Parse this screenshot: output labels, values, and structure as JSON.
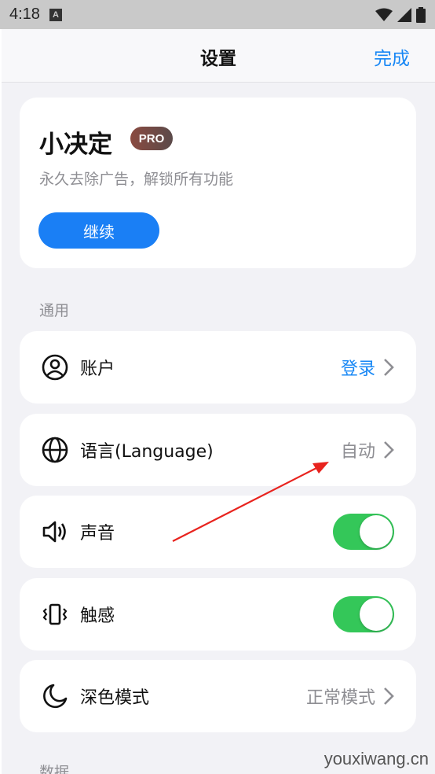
{
  "status_bar": {
    "time": "4:18",
    "notif_icon": "A"
  },
  "nav": {
    "title": "设置",
    "done": "完成"
  },
  "pro": {
    "title": "小决定",
    "badge": "PRO",
    "subtitle": "永久去除广告，解锁所有功能",
    "button": "继续"
  },
  "sections": {
    "general": "通用",
    "data": "数据"
  },
  "rows": {
    "account": {
      "label": "账户",
      "value": "登录",
      "icon": "person-circle-icon"
    },
    "language": {
      "label": "语言(Language)",
      "value": "自动",
      "icon": "globe-icon"
    },
    "sound": {
      "label": "声音",
      "on": true,
      "icon": "speaker-icon"
    },
    "haptics": {
      "label": "触感",
      "on": true,
      "icon": "vibration-icon"
    },
    "dark_mode": {
      "label": "深色模式",
      "value": "正常模式",
      "icon": "moon-icon"
    }
  },
  "watermark": "youxiwang.cn",
  "colors": {
    "accent": "#1787f5",
    "toggle_on": "#34c759",
    "secondary": "#8e8e93",
    "annotation": "#e8231e"
  }
}
